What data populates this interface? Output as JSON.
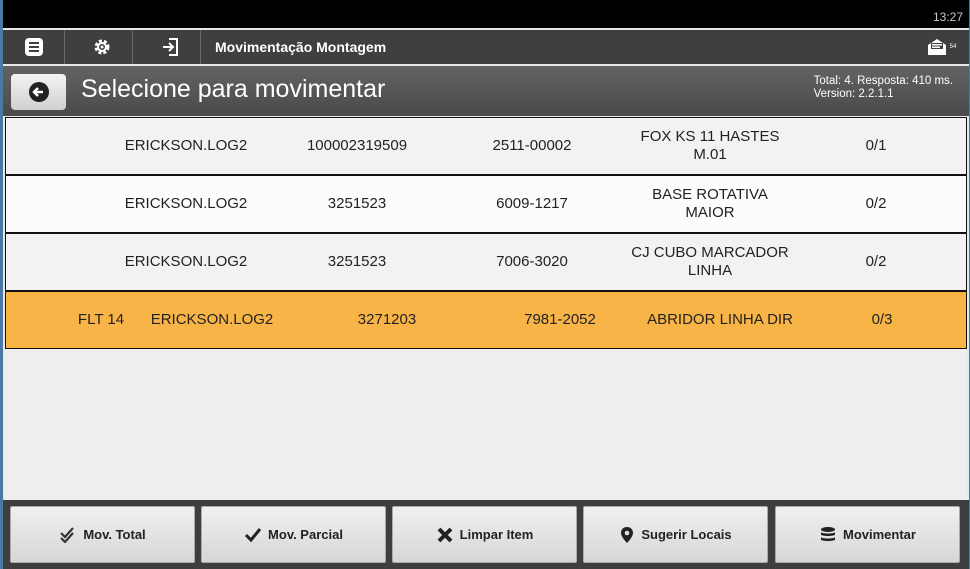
{
  "status_bar": {
    "clock": "13:27"
  },
  "top_bar": {
    "title": "Movimentação Montagem",
    "buttons": [
      "menu-icon",
      "gear-icon",
      "login-icon"
    ],
    "message_badge": "54"
  },
  "header": {
    "title": "Selecione para movimentar",
    "meta_line1": "Total: 4. Resposta: 410 ms.",
    "meta_line2": "Version: 2.2.1.1"
  },
  "rows": [
    {
      "flt": "",
      "user": "ERICKSON.LOG2",
      "code": "100002319509",
      "ref": "2511-00002",
      "desc_line1": "FOX KS 11 HASTES",
      "desc_line2": "M.01",
      "qty": "0/1"
    },
    {
      "flt": "",
      "user": "ERICKSON.LOG2",
      "code": "3251523",
      "ref": "6009-1217",
      "desc_line1": "BASE ROTATIVA",
      "desc_line2": "MAIOR",
      "qty": "0/2"
    },
    {
      "flt": "",
      "user": "ERICKSON.LOG2",
      "code": "3251523",
      "ref": "7006-3020",
      "desc_line1": "CJ CUBO MARCADOR",
      "desc_line2": "LINHA",
      "qty": "0/2"
    },
    {
      "flt": "FLT 14",
      "user": "ERICKSON.LOG2",
      "code": "3271203",
      "ref": "7981-2052",
      "desc_line1": "ABRIDOR LINHA DIR",
      "desc_line2": "",
      "qty": "0/3"
    }
  ],
  "footer": {
    "mov_total": "Mov. Total",
    "mov_parcial": "Mov. Parcial",
    "limpar_item": "Limpar Item",
    "sugerir_locais": "Sugerir Locais",
    "movimentar": "Movimentar"
  },
  "colors": {
    "selected_row": "#f8b447",
    "topbar": "#3f3f3f"
  }
}
